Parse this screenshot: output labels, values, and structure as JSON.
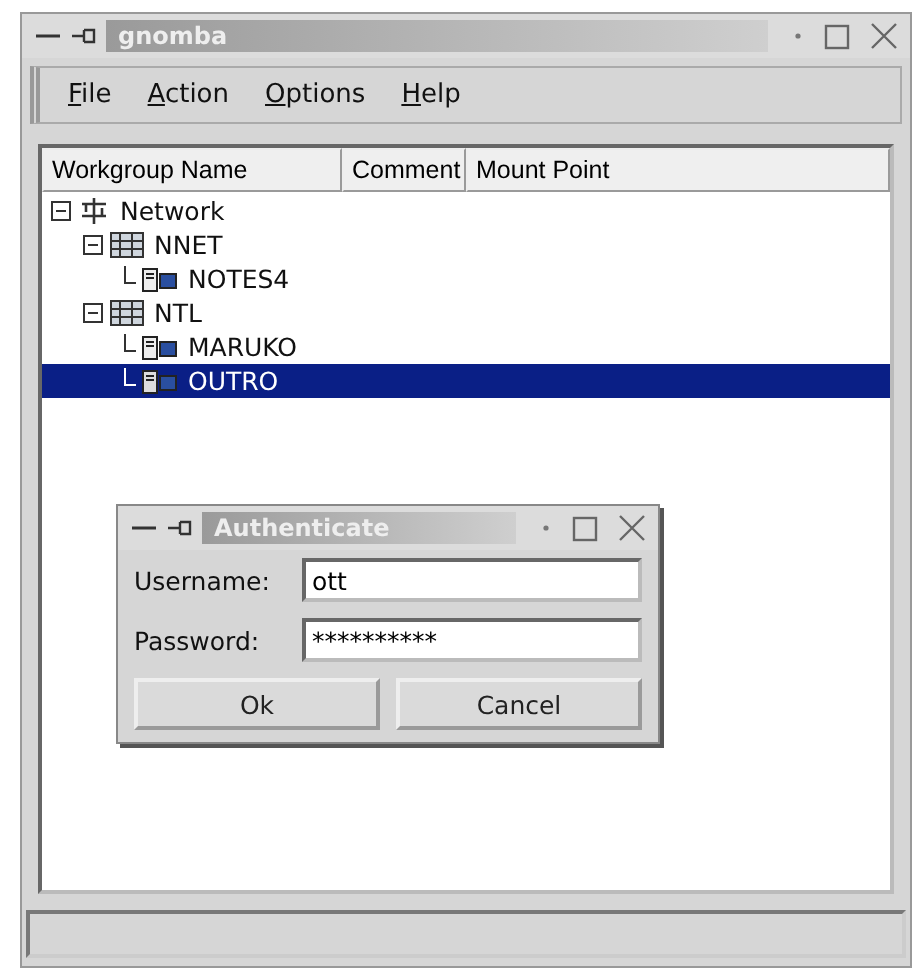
{
  "window": {
    "title": "gnomba"
  },
  "menu": [
    "File",
    "Action",
    "Options",
    "Help"
  ],
  "table": {
    "columns": [
      "Workgroup Name",
      "Comment",
      "Mount Point"
    ],
    "tree": [
      {
        "label": "Network",
        "kind": "network",
        "expanded": true,
        "selected": false,
        "children": [
          {
            "label": "NNET",
            "kind": "workgroup",
            "expanded": true,
            "selected": false,
            "children": [
              {
                "label": "NOTES4",
                "kind": "host",
                "selected": false
              }
            ]
          },
          {
            "label": "NTL",
            "kind": "workgroup",
            "expanded": true,
            "selected": false,
            "children": [
              {
                "label": "MARUKO",
                "kind": "host",
                "selected": false
              },
              {
                "label": "OUTRO",
                "kind": "host",
                "selected": true
              }
            ]
          }
        ]
      }
    ]
  },
  "dialog": {
    "title": "Authenticate",
    "fields": [
      {
        "label": "Username:",
        "value": "ott"
      },
      {
        "label": "Password:",
        "value": "**********"
      }
    ],
    "buttons": [
      "Ok",
      "Cancel"
    ]
  }
}
